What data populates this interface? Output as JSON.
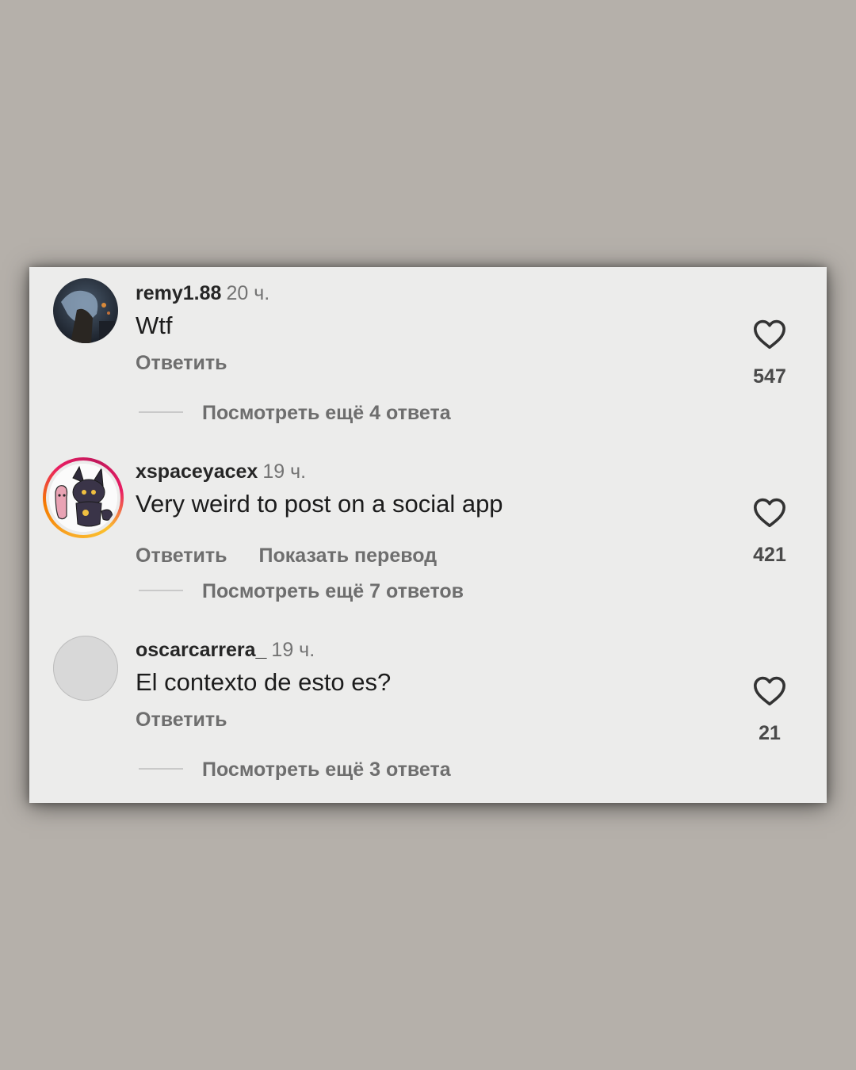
{
  "comments": [
    {
      "username": "remy1.88",
      "time": "20 ч.",
      "text": "Wtf",
      "reply_label": "Ответить",
      "likes": "547",
      "view_replies": "Посмотреть ещё 4 ответа",
      "avatar": "photo-avatar-dark"
    },
    {
      "username": "xspaceyacex",
      "time": "19 ч.",
      "text": "Very weird to post on a social app",
      "reply_label": "Ответить",
      "translate_label": "Показать перевод",
      "likes": "421",
      "view_replies": "Посмотреть ещё 7 ответов",
      "avatar": "cartoon-avatar-with-story-ring"
    },
    {
      "username": "oscarcarrera_",
      "time": "19 ч.",
      "text": "El contexto de esto es?",
      "reply_label": "Ответить",
      "likes": "21",
      "view_replies": "Посмотреть ещё 3 ответа",
      "avatar": "default-blank-avatar"
    }
  ],
  "icons": {
    "like": "heart-outline-icon"
  },
  "colors": {
    "background": "#b5b0aa",
    "card": "#ececeb",
    "username": "#262626",
    "secondary_text": "#737373",
    "story_ring": [
      "#f9a825",
      "#e91e63"
    ]
  }
}
